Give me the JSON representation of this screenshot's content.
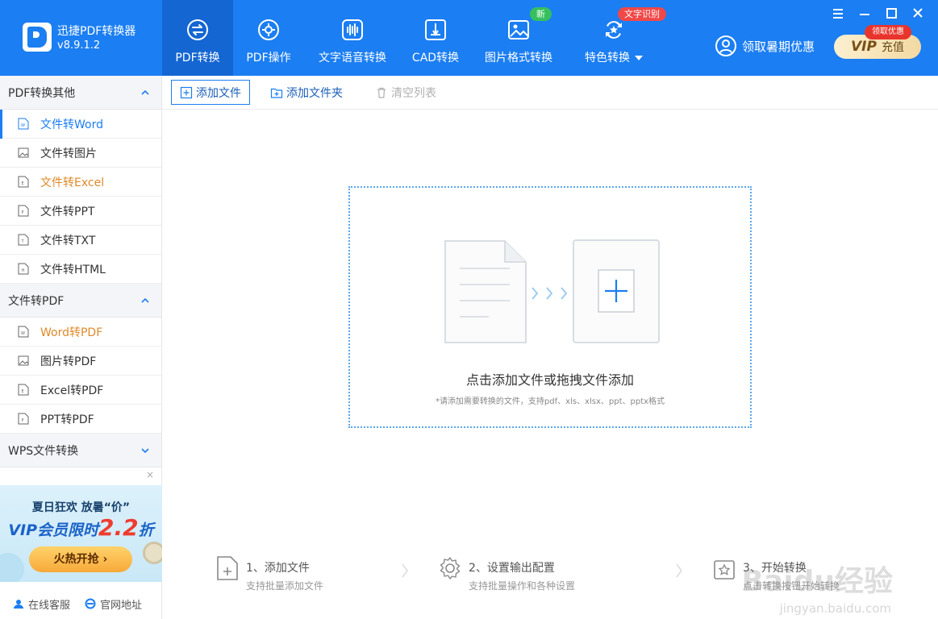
{
  "app": {
    "name": "迅捷PDF转换器",
    "version": "v8.9.1.2"
  },
  "colors": {
    "brand": "#1b7ef2",
    "brand_dark": "#1466d2",
    "accent_orange": "#e0892a",
    "badge_green": "#36c05c",
    "badge_red": "#f04848"
  },
  "nav": {
    "tabs": [
      {
        "label": "PDF转换",
        "icon": "pdf-convert-icon",
        "active": true
      },
      {
        "label": "PDF操作",
        "icon": "gear-icon"
      },
      {
        "label": "文字语音转换",
        "icon": "waveform-icon"
      },
      {
        "label": "CAD转换",
        "icon": "cad-icon"
      },
      {
        "label": "图片格式转换",
        "icon": "image-icon",
        "badge": "新"
      },
      {
        "label": "特色转换",
        "icon": "star-icon",
        "badge": "文字识别"
      }
    ]
  },
  "header_right": {
    "promo": "领取暑期优惠",
    "vip_mark": "VIP",
    "vip_label": "充值",
    "vip_badge": "领取优惠"
  },
  "toolbar": {
    "add_file": "添加文件",
    "add_folder": "添加文件夹",
    "clear_list": "清空列表"
  },
  "sidebar": {
    "sections": [
      {
        "title": "PDF转换其他",
        "items": [
          "文件转Word",
          "文件转图片",
          "文件转Excel",
          "文件转PPT",
          "文件转TXT",
          "文件转HTML"
        ]
      },
      {
        "title": "文件转PDF",
        "items": [
          "Word转PDF",
          "图片转PDF",
          "Excel转PDF",
          "PPT转PDF"
        ]
      },
      {
        "title": "WPS文件转换"
      }
    ],
    "ad": {
      "line1": "夏日狂欢 放暑“价”",
      "line2_prefix": "VIP会员限时",
      "line2_big": "2.2",
      "line2_suffix": "折",
      "button": "火热开抢 ›",
      "close": "×"
    },
    "footer": {
      "service": "在线客服",
      "website": "官网地址"
    }
  },
  "dropzone": {
    "title": "点击添加文件或拖拽文件添加",
    "hint": "*请添加需要转换的文件，支持pdf、xls、xlsx、ppt、pptx格式"
  },
  "steps": [
    {
      "title": "1、添加文件",
      "desc": "支持批量添加文件"
    },
    {
      "title": "2、设置输出配置",
      "desc": "支持批量操作和各种设置"
    },
    {
      "title": "3、开始转换",
      "desc": "点击转换按钮开始转换"
    }
  ],
  "watermark": {
    "main": "Baidu经验",
    "sub": "jingyan.baidu.com"
  }
}
